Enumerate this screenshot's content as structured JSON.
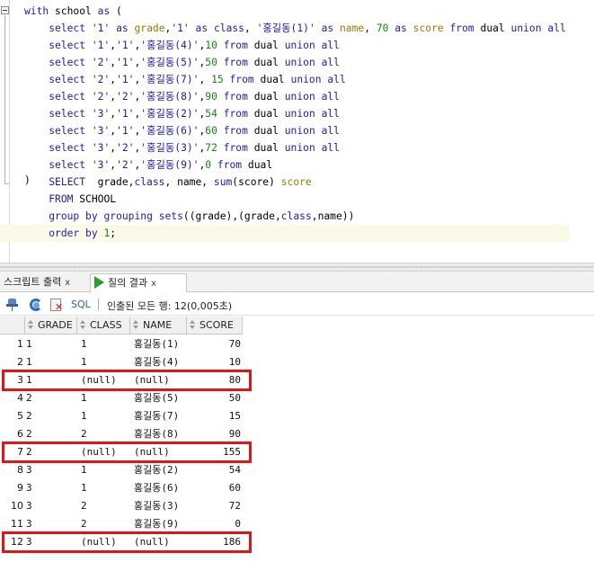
{
  "editor": {
    "lines": [
      {
        "parts": [
          [
            "kw",
            "with"
          ],
          [
            "t",
            " school "
          ],
          [
            "kw",
            "as"
          ],
          [
            "t",
            " ("
          ]
        ]
      },
      {
        "parts": [
          [
            "t",
            "    "
          ],
          [
            "kw",
            "select"
          ],
          [
            "t",
            " "
          ],
          [
            "str",
            "'1'"
          ],
          [
            "t",
            " "
          ],
          [
            "kw",
            "as"
          ],
          [
            "t",
            " "
          ],
          [
            "id",
            "grade"
          ],
          [
            "t",
            ","
          ],
          [
            "str",
            "'1'"
          ],
          [
            "t",
            " "
          ],
          [
            "kw",
            "as"
          ],
          [
            "t",
            " "
          ],
          [
            "kw",
            "class"
          ],
          [
            "t",
            ", "
          ],
          [
            "str",
            "'홍길동(1)'"
          ],
          [
            "t",
            " "
          ],
          [
            "kw",
            "as"
          ],
          [
            "t",
            " "
          ],
          [
            "id",
            "name"
          ],
          [
            "t",
            ", "
          ],
          [
            "num",
            "70"
          ],
          [
            "t",
            " "
          ],
          [
            "kw",
            "as"
          ],
          [
            "t",
            " "
          ],
          [
            "id",
            "score"
          ],
          [
            "t",
            " "
          ],
          [
            "kw",
            "from"
          ],
          [
            "t",
            " dual "
          ],
          [
            "kw",
            "union"
          ],
          [
            "t",
            " "
          ],
          [
            "kw",
            "all"
          ]
        ]
      },
      {
        "parts": [
          [
            "t",
            "    "
          ],
          [
            "kw",
            "select"
          ],
          [
            "t",
            " "
          ],
          [
            "str",
            "'1'"
          ],
          [
            "t",
            ","
          ],
          [
            "str",
            "'1'"
          ],
          [
            "t",
            ","
          ],
          [
            "str",
            "'홍길동(4)'"
          ],
          [
            "t",
            ","
          ],
          [
            "num",
            "10"
          ],
          [
            "t",
            " "
          ],
          [
            "kw",
            "from"
          ],
          [
            "t",
            " dual "
          ],
          [
            "kw",
            "union"
          ],
          [
            "t",
            " "
          ],
          [
            "kw",
            "all"
          ]
        ]
      },
      {
        "parts": [
          [
            "t",
            "    "
          ],
          [
            "kw",
            "select"
          ],
          [
            "t",
            " "
          ],
          [
            "str",
            "'2'"
          ],
          [
            "t",
            ","
          ],
          [
            "str",
            "'1'"
          ],
          [
            "t",
            ","
          ],
          [
            "str",
            "'홍길동(5)'"
          ],
          [
            "t",
            ","
          ],
          [
            "num",
            "50"
          ],
          [
            "t",
            " "
          ],
          [
            "kw",
            "from"
          ],
          [
            "t",
            " dual "
          ],
          [
            "kw",
            "union"
          ],
          [
            "t",
            " "
          ],
          [
            "kw",
            "all"
          ]
        ]
      },
      {
        "parts": [
          [
            "t",
            "    "
          ],
          [
            "kw",
            "select"
          ],
          [
            "t",
            " "
          ],
          [
            "str",
            "'2'"
          ],
          [
            "t",
            ","
          ],
          [
            "str",
            "'1'"
          ],
          [
            "t",
            ","
          ],
          [
            "str",
            "'홍길동(7)'"
          ],
          [
            "t",
            ", "
          ],
          [
            "num",
            "15"
          ],
          [
            "t",
            " "
          ],
          [
            "kw",
            "from"
          ],
          [
            "t",
            " dual "
          ],
          [
            "kw",
            "union"
          ],
          [
            "t",
            " "
          ],
          [
            "kw",
            "all"
          ]
        ]
      },
      {
        "parts": [
          [
            "t",
            "    "
          ],
          [
            "kw",
            "select"
          ],
          [
            "t",
            " "
          ],
          [
            "str",
            "'2'"
          ],
          [
            "t",
            ","
          ],
          [
            "str",
            "'2'"
          ],
          [
            "t",
            ","
          ],
          [
            "str",
            "'홍길동(8)'"
          ],
          [
            "t",
            ","
          ],
          [
            "num",
            "90"
          ],
          [
            "t",
            " "
          ],
          [
            "kw",
            "from"
          ],
          [
            "t",
            " dual "
          ],
          [
            "kw",
            "union"
          ],
          [
            "t",
            " "
          ],
          [
            "kw",
            "all"
          ]
        ]
      },
      {
        "parts": [
          [
            "t",
            "    "
          ],
          [
            "kw",
            "select"
          ],
          [
            "t",
            " "
          ],
          [
            "str",
            "'3'"
          ],
          [
            "t",
            ","
          ],
          [
            "str",
            "'1'"
          ],
          [
            "t",
            ","
          ],
          [
            "str",
            "'홍길동(2)'"
          ],
          [
            "t",
            ","
          ],
          [
            "num",
            "54"
          ],
          [
            "t",
            " "
          ],
          [
            "kw",
            "from"
          ],
          [
            "t",
            " dual "
          ],
          [
            "kw",
            "union"
          ],
          [
            "t",
            " "
          ],
          [
            "kw",
            "all"
          ]
        ]
      },
      {
        "parts": [
          [
            "t",
            "    "
          ],
          [
            "kw",
            "select"
          ],
          [
            "t",
            " "
          ],
          [
            "str",
            "'3'"
          ],
          [
            "t",
            ","
          ],
          [
            "str",
            "'1'"
          ],
          [
            "t",
            ","
          ],
          [
            "str",
            "'홍길동(6)'"
          ],
          [
            "t",
            ","
          ],
          [
            "num",
            "60"
          ],
          [
            "t",
            " "
          ],
          [
            "kw",
            "from"
          ],
          [
            "t",
            " dual "
          ],
          [
            "kw",
            "union"
          ],
          [
            "t",
            " "
          ],
          [
            "kw",
            "all"
          ]
        ]
      },
      {
        "parts": [
          [
            "t",
            "    "
          ],
          [
            "kw",
            "select"
          ],
          [
            "t",
            " "
          ],
          [
            "str",
            "'3'"
          ],
          [
            "t",
            ","
          ],
          [
            "str",
            "'2'"
          ],
          [
            "t",
            ","
          ],
          [
            "str",
            "'홍길동(3)'"
          ],
          [
            "t",
            ","
          ],
          [
            "num",
            "72"
          ],
          [
            "t",
            " "
          ],
          [
            "kw",
            "from"
          ],
          [
            "t",
            " dual "
          ],
          [
            "kw",
            "union"
          ],
          [
            "t",
            " "
          ],
          [
            "kw",
            "all"
          ]
        ]
      },
      {
        "parts": [
          [
            "t",
            "    "
          ],
          [
            "kw",
            "select"
          ],
          [
            "t",
            " "
          ],
          [
            "str",
            "'3'"
          ],
          [
            "t",
            ","
          ],
          [
            "str",
            "'2'"
          ],
          [
            "t",
            ","
          ],
          [
            "str",
            "'홍길동(9)'"
          ],
          [
            "t",
            ","
          ],
          [
            "num",
            "0"
          ],
          [
            "t",
            " "
          ],
          [
            "kw",
            "from"
          ],
          [
            "t",
            " dual"
          ]
        ]
      },
      {
        "parts": [
          [
            "t",
            "    "
          ],
          [
            "kw",
            "SELECT"
          ],
          [
            "t",
            "  grade,"
          ],
          [
            "kw",
            "class"
          ],
          [
            "t",
            ", name, "
          ],
          [
            "kw",
            "sum"
          ],
          [
            "t",
            "(score) "
          ],
          [
            "id",
            "score"
          ]
        ]
      },
      {
        "parts": [
          [
            "t",
            "    "
          ],
          [
            "kw",
            "FROM"
          ],
          [
            "t",
            " SCHOOL"
          ]
        ]
      },
      {
        "parts": [
          [
            "t",
            "    "
          ],
          [
            "kw",
            "group"
          ],
          [
            "t",
            " "
          ],
          [
            "kw",
            "by"
          ],
          [
            "t",
            " "
          ],
          [
            "kw",
            "grouping"
          ],
          [
            "t",
            " "
          ],
          [
            "kw",
            "sets"
          ],
          [
            "t",
            "((grade),(grade,"
          ],
          [
            "kw",
            "class"
          ],
          [
            "t",
            ",name))"
          ]
        ]
      },
      {
        "parts": [
          [
            "t",
            "    "
          ],
          [
            "kw",
            "order"
          ],
          [
            "t",
            " "
          ],
          [
            "kw",
            "by"
          ],
          [
            "t",
            " "
          ],
          [
            "num",
            "1"
          ],
          [
            "t",
            ";"
          ]
        ]
      }
    ],
    "close_paren": ")"
  },
  "tabs": [
    {
      "label": "스크립트 출력",
      "close": "x"
    },
    {
      "label": "질의 결과",
      "close": "x"
    }
  ],
  "toolbar": {
    "sql_label": "SQL",
    "status": "인출된 모든 행: 12(0,005초)"
  },
  "columns": [
    "GRADE",
    "CLASS",
    "NAME",
    "SCORE"
  ],
  "rows": [
    {
      "n": "1",
      "grade": "1",
      "class": "1",
      "name": "홍길동(1)",
      "score": "70"
    },
    {
      "n": "2",
      "grade": "1",
      "class": "1",
      "name": "홍길동(4)",
      "score": "10"
    },
    {
      "n": "3",
      "grade": "1",
      "class": "(null)",
      "name": "(null)",
      "score": "80"
    },
    {
      "n": "4",
      "grade": "2",
      "class": "1",
      "name": "홍길동(5)",
      "score": "50"
    },
    {
      "n": "5",
      "grade": "2",
      "class": "1",
      "name": "홍길동(7)",
      "score": "15"
    },
    {
      "n": "6",
      "grade": "2",
      "class": "2",
      "name": "홍길동(8)",
      "score": "90"
    },
    {
      "n": "7",
      "grade": "2",
      "class": "(null)",
      "name": "(null)",
      "score": "155"
    },
    {
      "n": "8",
      "grade": "3",
      "class": "1",
      "name": "홍길동(2)",
      "score": "54"
    },
    {
      "n": "9",
      "grade": "3",
      "class": "1",
      "name": "홍길동(6)",
      "score": "60"
    },
    {
      "n": "10",
      "grade": "3",
      "class": "2",
      "name": "홍길동(3)",
      "score": "72"
    },
    {
      "n": "11",
      "grade": "3",
      "class": "2",
      "name": "홍길동(9)",
      "score": "0"
    },
    {
      "n": "12",
      "grade": "3",
      "class": "(null)",
      "name": "(null)",
      "score": "186"
    }
  ],
  "highlighted_rows": [
    3,
    7,
    12
  ],
  "colors": {
    "highlight": "#e01515",
    "keyword": "#1b1bb5",
    "number": "#118711",
    "identifier": "#9a7a00"
  }
}
